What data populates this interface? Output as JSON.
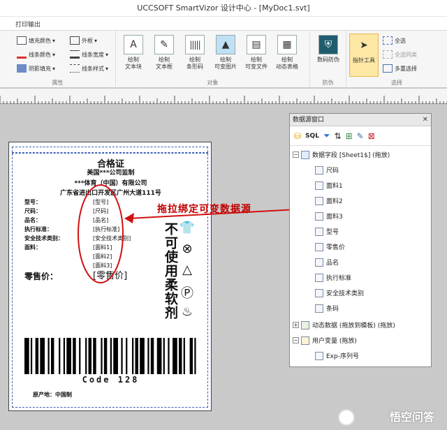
{
  "window": {
    "title": "UCCSOFT SmartVizor 设计中心 - [MyDoc1.svt]"
  },
  "menu": {
    "tab": "打印输出"
  },
  "ribbon": {
    "property_group": {
      "label": "属性",
      "fill_color": "填充颜色",
      "line_color": "线条颜色",
      "shadow_fill": "阴影填充",
      "border": "外框",
      "line_width": "线条宽度",
      "line_style": "线条样式"
    },
    "object_group": {
      "label": "对象",
      "buttons": [
        "绘制\n文本块",
        "绘制\n文本框",
        "绘制\n条形码",
        "绘制\n可变图片",
        "绘制\n可变文件",
        "绘制\n动态表格"
      ]
    },
    "security_group": {
      "label": "防伪",
      "button": "数码防伪"
    },
    "select_group": {
      "label": "选择",
      "pointer": "指针工具",
      "select_all": "全选",
      "select_same": "全选同类",
      "multi_select": "多重选择"
    }
  },
  "label": {
    "title": "合格证",
    "line1": "美国***公司监制",
    "line2": "***体育（中国）有限公司",
    "line3": "广东省进出口开发区广州大道111号",
    "fields": [
      {
        "name": "型号：",
        "value": "[型号]"
      },
      {
        "name": "尺码：",
        "value": "[尺码]"
      },
      {
        "name": "品名：",
        "value": "[品名]"
      },
      {
        "name": "执行标准：",
        "value": "[执行标准]"
      },
      {
        "name": "安全技术类别：",
        "value": "[安全技术类别]"
      },
      {
        "name": "面料：",
        "value": "[面料1]"
      },
      {
        "name": "",
        "value": "[面料2]"
      },
      {
        "name": "",
        "value": "[面料3]"
      }
    ],
    "price_label": "零售价：",
    "price_value": "[零售价]",
    "vertical_text": "不可使用柔软剂",
    "barcode_text": "Code 128",
    "origin": "原产地：中国制"
  },
  "datasource": {
    "title": "数据源窗口",
    "root": "数据字段 [Sheet1$] (拖放)",
    "fields": [
      "尺码",
      "面料1",
      "面料2",
      "面料3",
      "型号",
      "零售价",
      "品名",
      "执行标准",
      "安全技术类别",
      "条码"
    ],
    "dynamic": "动态数据 (拖放到模板) (拖放)",
    "uservars": "用户变量 (拖放)",
    "serial": "Exp-序列号"
  },
  "annotation": "拖拉绑定可变数据源",
  "watermark": "悟空问答",
  "colors": {
    "annotation": "#c00000",
    "selected": "#fde7a5"
  }
}
